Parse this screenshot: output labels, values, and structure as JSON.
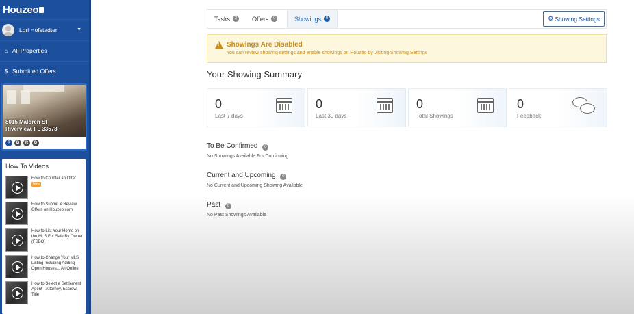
{
  "app": {
    "logo": "Houzeo"
  },
  "sidebar": {
    "user_name": "Lori Hofstadter",
    "nav": [
      {
        "label": "All Properties",
        "icon": "home-icon"
      },
      {
        "label": "Submitted Offers",
        "icon": "dollar-icon"
      }
    ],
    "property": {
      "address_line1": "8015 Maloren St",
      "address_line2": "Riverview, FL 33578",
      "status_icons": [
        "R",
        "B",
        "R",
        "D"
      ]
    },
    "videos": {
      "title": "How To Videos",
      "items": [
        {
          "title": "How to Counter an Offer",
          "badge": "New"
        },
        {
          "title": "How to Submit & Review Offers on Houzeo.com",
          "badge": ""
        },
        {
          "title": "How to List Your Home on the MLS For Sale By Owner (FSBO)",
          "badge": ""
        },
        {
          "title": "How to Change Your MLS Listing Including Adding Open Houses... All Online!",
          "badge": ""
        },
        {
          "title": "How to Select a Settlement Agent - Attorney, Escrow, Title",
          "badge": ""
        }
      ]
    }
  },
  "tabs": [
    {
      "label": "Tasks",
      "count": "2"
    },
    {
      "label": "Offers",
      "count": "0"
    },
    {
      "label": "Showings",
      "count": "0"
    }
  ],
  "settings_button": "Showing Settings",
  "alert": {
    "title": "Showings Are Disabled",
    "text": "You can review showing settings and enable showings on Houzeo by visiting Showing Settings"
  },
  "summary": {
    "title": "Your Showing Summary",
    "stats": [
      {
        "value": "0",
        "label": "Last 7 days",
        "icon": "calendar-icon"
      },
      {
        "value": "0",
        "label": "Last 30 days",
        "icon": "calendar-icon"
      },
      {
        "value": "0",
        "label": "Total Showings",
        "icon": "calendar-check-icon"
      },
      {
        "value": "0",
        "label": "Feedback",
        "icon": "chat-bubbles-icon"
      }
    ]
  },
  "sections": [
    {
      "title": "To Be Confirmed",
      "count": "0",
      "empty": "No Showings Available For Confirming"
    },
    {
      "title": "Current and Upcoming",
      "count": "0",
      "empty": "No Current and Upcoming Showing Available"
    },
    {
      "title": "Past",
      "count": "0",
      "empty": "No Past Showings Available"
    }
  ]
}
